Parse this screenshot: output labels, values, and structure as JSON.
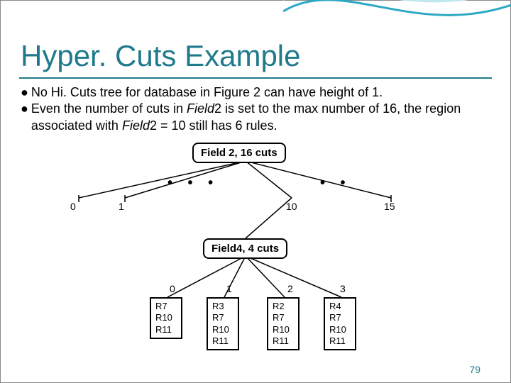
{
  "slide": {
    "title": "Hyper. Cuts Example",
    "page_number": "79"
  },
  "bullets": [
    {
      "pre": "No Hi. Cuts tree for database in Figure 2 can have height of 1."
    },
    {
      "pre": "Even the number of cuts in ",
      "it1": "Field",
      "mid1": "2 is set to the max number of 16, the region associated with ",
      "it2": "Field",
      "post": "2 = 10 still has 6 rules."
    }
  ],
  "diagram": {
    "root_label": "Field 2, 16 cuts",
    "top_edge_labels": [
      "0",
      "1",
      "10",
      "15"
    ],
    "mid_label": "Field4, 4 cuts",
    "bottom_edge_labels": [
      "0",
      "1",
      "2",
      "3"
    ],
    "leaves": [
      [
        "R7",
        "R10",
        "R11"
      ],
      [
        "R3",
        "R7",
        "R10",
        "R11"
      ],
      [
        "R2",
        "R7",
        "R10",
        "R11"
      ],
      [
        "R4",
        "R7",
        "R10",
        "R11"
      ]
    ]
  }
}
